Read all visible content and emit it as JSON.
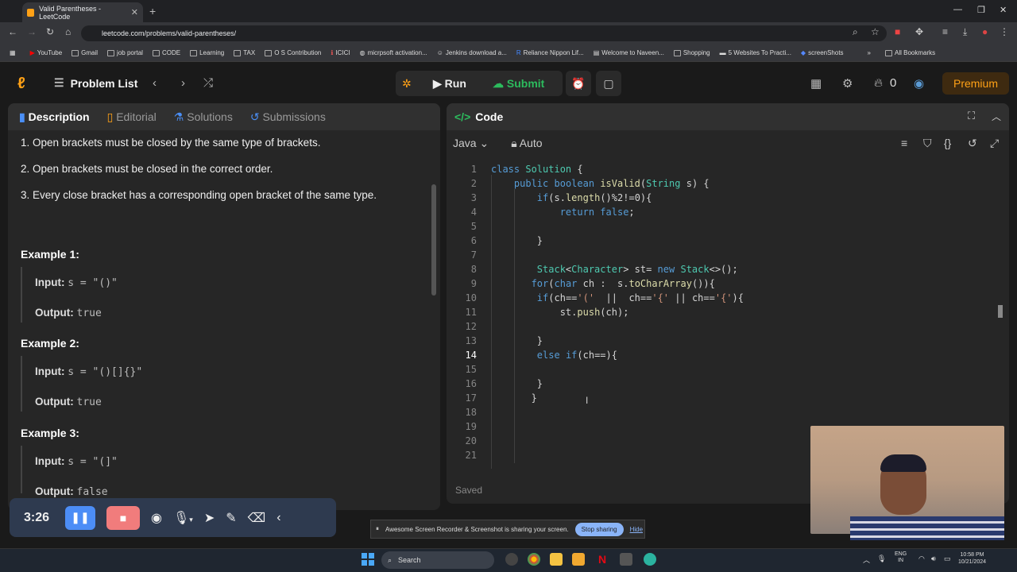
{
  "browser": {
    "tab_title": "Valid Parentheses - LeetCode",
    "url": "leetcode.com/problems/valid-parentheses/",
    "bookmarks": [
      "YouTube",
      "Gmail",
      "job portal",
      "CODE",
      "Learning",
      "TAX",
      "O S Contribution",
      "ICICI",
      "micrpsoft activation...",
      "Jenkins download a...",
      "Reliance Nippon Lif...",
      "Welcome to Naveen...",
      "Shopping",
      "5 Websites To Practi...",
      "screenShots",
      "All Bookmarks"
    ]
  },
  "nav": {
    "problem_list": "Problem List",
    "run": "Run",
    "submit": "Submit",
    "streak": "0",
    "premium": "Premium"
  },
  "left_tabs": [
    "Description",
    "Editorial",
    "Solutions",
    "Submissions"
  ],
  "description": {
    "points": [
      "1. Open brackets must be closed by the same type of brackets.",
      "2. Open brackets must be closed in the correct order.",
      "3. Every close bracket has a corresponding open bracket of the same type."
    ],
    "examples": [
      {
        "title": "Example 1:",
        "input_label": "Input:",
        "input": "s = \"()\"",
        "output_label": "Output:",
        "output": "true"
      },
      {
        "title": "Example 2:",
        "input_label": "Input:",
        "input": "s = \"()[]{}\"",
        "output_label": "Output:",
        "output": "true"
      },
      {
        "title": "Example 3:",
        "input_label": "Input:",
        "input": "s = \"(]\"",
        "output_label": "Output:",
        "output": "false"
      }
    ]
  },
  "code_panel": {
    "title": "Code",
    "language": "Java",
    "mode": "Auto",
    "status": "Saved",
    "current_line": 14,
    "line_numbers": [
      "1",
      "2",
      "3",
      "4",
      "5",
      "6",
      "7",
      "8",
      "9",
      "10",
      "11",
      "12",
      "13",
      "14",
      "15",
      "16",
      "17",
      "18",
      "19",
      "20",
      "21"
    ],
    "lines": [
      "class Solution {",
      "    public boolean isValid(String s) {",
      "        if(s.length()%2!=0){",
      "            return false;",
      "",
      "        }",
      "",
      "        Stack<Character> st= new Stack<>();",
      "       for(char ch :  s.toCharArray()){",
      "        if(ch=='('  ||  ch=='{' || ch=='{'){",
      "            st.push(ch);",
      "",
      "        }",
      "        else if(ch==){",
      "",
      "        }",
      "       }",
      "",
      "",
      "",
      ""
    ]
  },
  "recorder": {
    "time": "3:26",
    "share_message": "Awesome Screen Recorder & Screenshot is sharing your screen.",
    "stop_sharing": "Stop sharing",
    "hide": "Hide"
  },
  "taskbar": {
    "search": "Search",
    "lang1": "ENG",
    "lang2": "IN",
    "time": "10:58 PM",
    "date": "10/21/2024"
  }
}
